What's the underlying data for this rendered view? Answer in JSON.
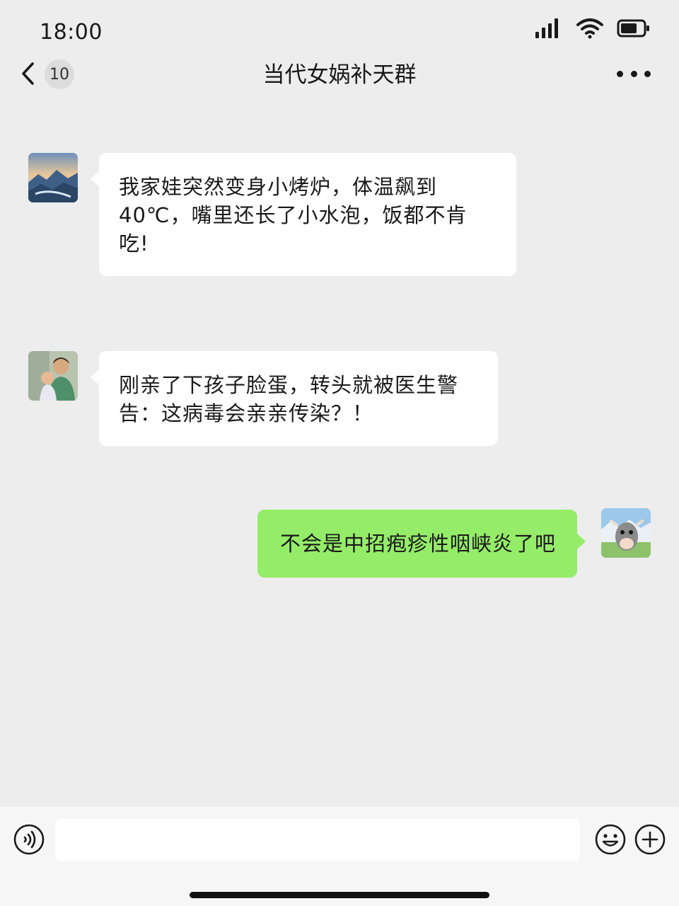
{
  "status_bar": {
    "time": "18:00"
  },
  "nav_bar": {
    "unread_count": "10",
    "title": "当代女娲补天群"
  },
  "messages": [
    {
      "direction": "incoming",
      "avatar_icon": "mountain-landscape-avatar",
      "text_lines": [
        "我家娃突然变身小烤炉，体温飙到",
        "40℃，嘴里还长了小水泡，饭都不肯",
        "吃!"
      ]
    },
    {
      "direction": "incoming",
      "avatar_icon": "mother-child-photo-avatar",
      "text_lines": [
        "刚亲了下孩子脸蛋，转头就被医生警",
        "告：这病毒会亲亲传染？！"
      ]
    },
    {
      "direction": "outgoing",
      "avatar_icon": "cow-cartoon-avatar",
      "text_lines": [
        "不会是中招疱疹性咽峡炎了吧"
      ]
    }
  ],
  "input_bar": {
    "value": "",
    "icons": [
      "voice-icon",
      "emoji-icon",
      "plus-icon"
    ]
  },
  "colors": {
    "background": "#ededed",
    "incoming_bubble": "#ffffff",
    "outgoing_bubble": "#95ec69"
  }
}
